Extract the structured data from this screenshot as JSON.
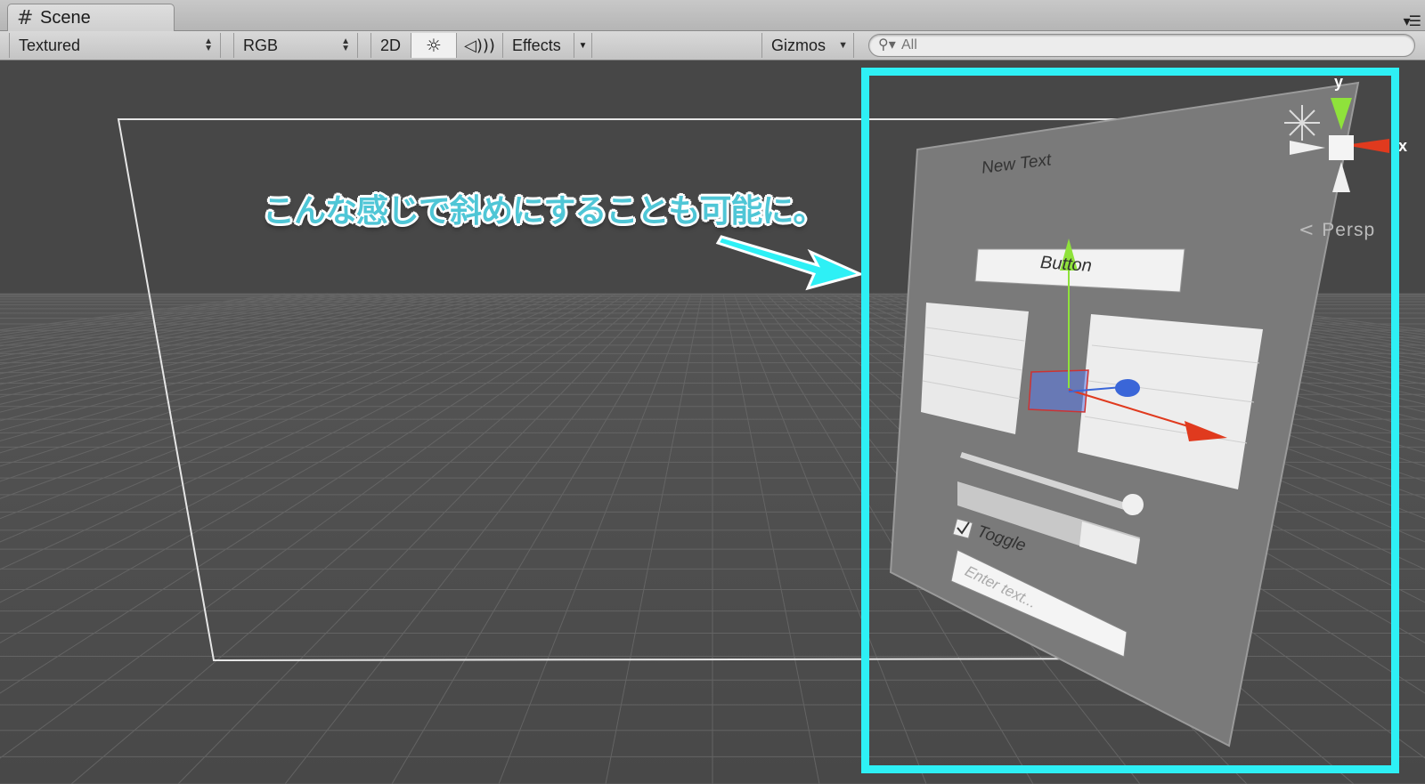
{
  "tab": {
    "label": "Scene",
    "icon": "grid-icon"
  },
  "toolbar": {
    "shading": "Textured",
    "render_mode": "RGB",
    "toggle_2d": "2D",
    "effects": "Effects",
    "gizmos": "Gizmos",
    "search_placeholder": "All"
  },
  "gizmo": {
    "y_label": "y",
    "x_label": "x",
    "persp_label": "Persp"
  },
  "canvas": {
    "text_label": "New Text",
    "button_label": "Button",
    "toggle_label": "Toggle",
    "input_placeholder": "Enter text..."
  },
  "annotation": {
    "text": "こんな感じで斜めにすることも可能に。"
  },
  "colors": {
    "highlight": "#2ef0f5",
    "annotation": "#4fc6d6",
    "x_axis": "#e03a1e",
    "y_axis": "#8fe23b",
    "z_axis": "#3a66d8"
  }
}
